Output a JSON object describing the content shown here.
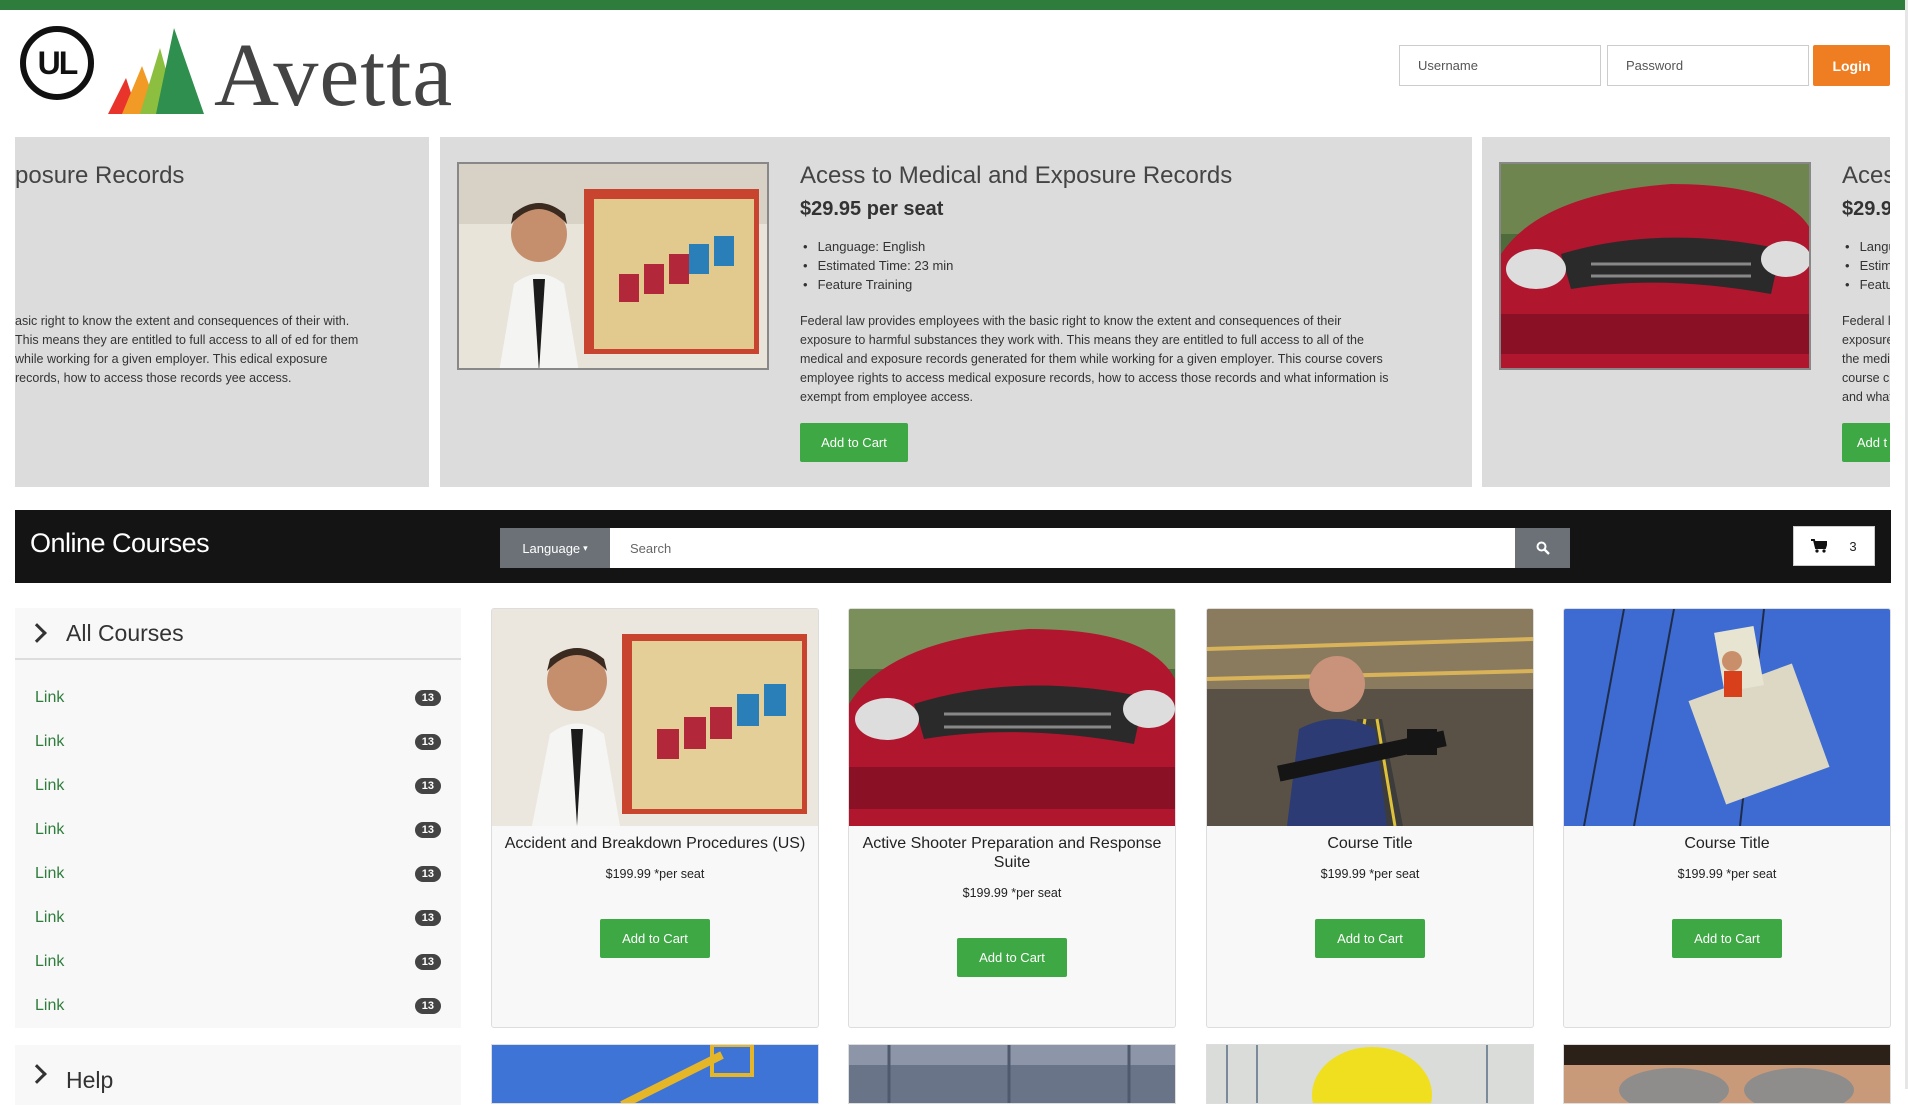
{
  "brand": {
    "ul_text": "UL",
    "name": "Avetta"
  },
  "login": {
    "username_placeholder": "Username",
    "password_placeholder": "Password",
    "button": "Login"
  },
  "carousel": {
    "left_fragment": {
      "title": "posure Records",
      "desc": "asic right to know the extent and consequences of their with. This means they are entitled to full access to all of ed for them while working for a given employer. This edical exposure records, how to access those records yee access."
    },
    "active": {
      "title": "Acess to Medical and Exposure Records",
      "price": "$29.95 per seat",
      "details": [
        "Language: English",
        "Estimated Time: 23 min",
        "Feature Training"
      ],
      "desc": "Federal law provides employees with the basic right to know the extent and consequences of their exposure to harmful substances they work with. This means they are entitled to full access to all of the medical and exposure records generated for them while working for a given employer. This course covers employee rights to access medical exposure records, how to access those records and what information is exempt from employee access.",
      "button": "Add to Cart"
    },
    "right_fragment": {
      "title": "Aces",
      "price": "$29.9",
      "details": [
        "Langu",
        "Estima",
        "Featu"
      ],
      "desc_lines": [
        "Federal l",
        "exposure",
        "the medi",
        "course c",
        "and what"
      ],
      "button": "Add t"
    }
  },
  "nav": {
    "title": "Online Courses",
    "language_button": "Language",
    "search_placeholder": "Search",
    "cart_count": "3"
  },
  "sidebar": {
    "heading": "All Courses",
    "items": [
      {
        "label": "Link",
        "count": "13"
      },
      {
        "label": "Link",
        "count": "13"
      },
      {
        "label": "Link",
        "count": "13"
      },
      {
        "label": "Link",
        "count": "13"
      },
      {
        "label": "Link",
        "count": "13"
      },
      {
        "label": "Link",
        "count": "13"
      },
      {
        "label": "Link",
        "count": "13"
      },
      {
        "label": "Link",
        "count": "13"
      }
    ],
    "help_heading": "Help"
  },
  "courses": [
    {
      "title": "Accident and Breakdown Procedures (US)",
      "price": "$199.99 *per seat",
      "button": "Add to Cart"
    },
    {
      "title": "Active Shooter Preparation and Response Suite",
      "price": "$199.99 *per seat",
      "button": "Add to Cart"
    },
    {
      "title": "Course Title",
      "price": "$199.99 *per seat",
      "button": "Add to Cart"
    },
    {
      "title": "Course Title",
      "price": "$199.99 *per seat",
      "button": "Add to Cart"
    }
  ],
  "colors": {
    "brand_green": "#2e7d3c",
    "button_green": "#3ea844",
    "login_orange": "#ef7d22",
    "nav_bg": "#141414"
  }
}
